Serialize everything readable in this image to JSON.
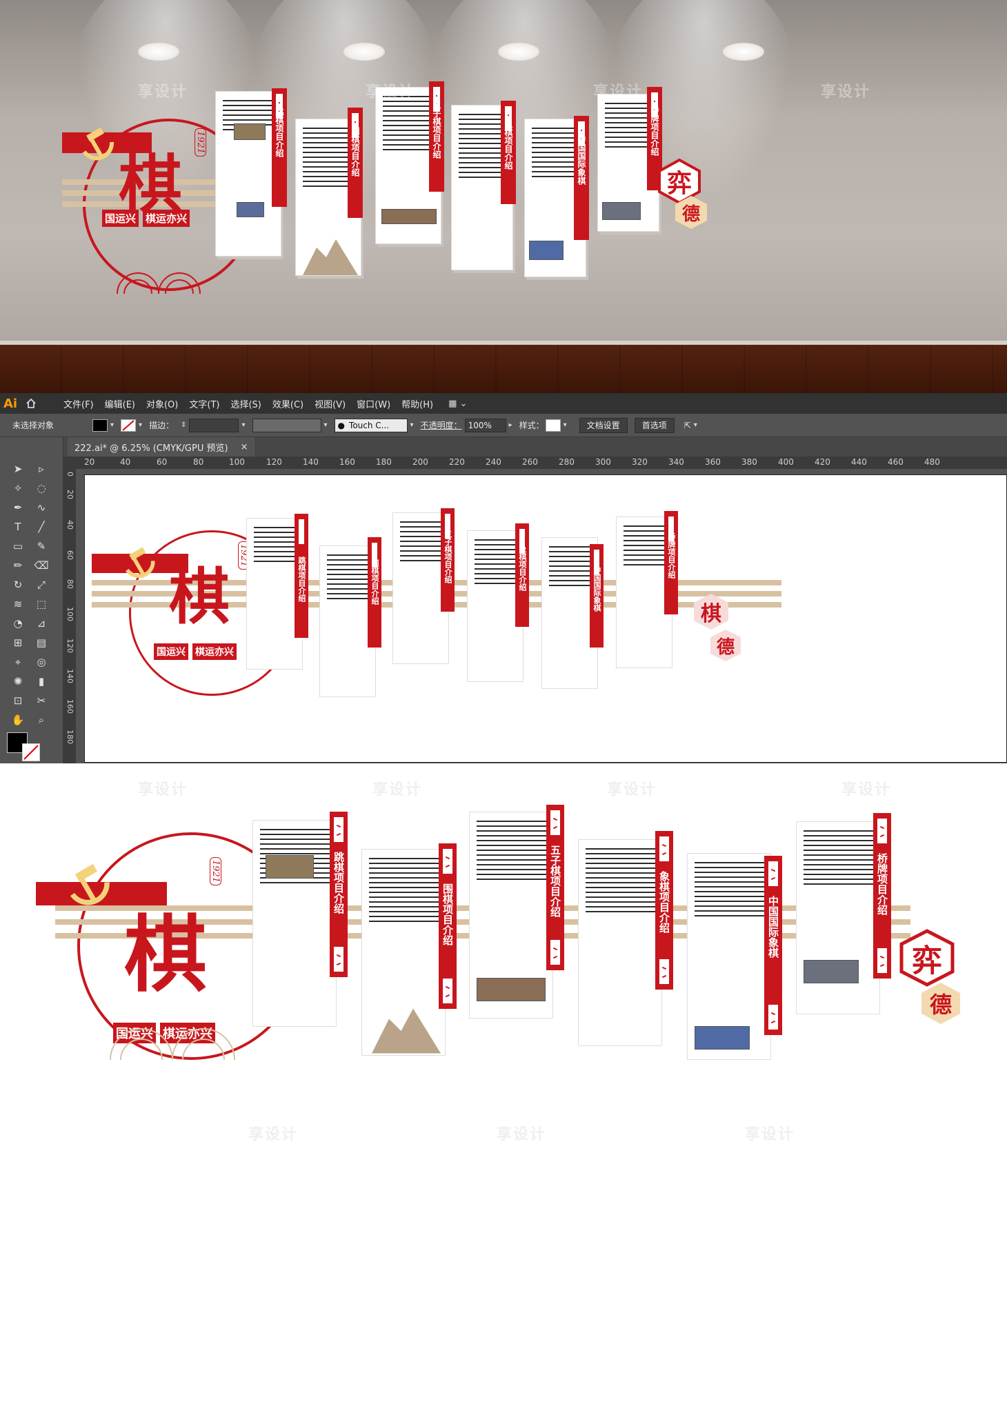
{
  "wall": {
    "main_char": "棋",
    "year": "1921",
    "slogan": [
      "国运兴",
      "棋运亦兴"
    ],
    "hex_chars": [
      "弈",
      "德"
    ],
    "panels": [
      {
        "title": "跳棋项目介绍"
      },
      {
        "title": "围棋项目介绍"
      },
      {
        "title": "五子棋项目介绍"
      },
      {
        "title": "象棋项目介绍"
      },
      {
        "title": "中国国际象棋"
      },
      {
        "title": "桥牌项目介绍"
      }
    ],
    "watermark": "享设计"
  },
  "illustrator": {
    "app_logo": "Ai",
    "menu": [
      "文件(F)",
      "编辑(E)",
      "对象(O)",
      "文字(T)",
      "选择(S)",
      "效果(C)",
      "视图(V)",
      "窗口(W)",
      "帮助(H)"
    ],
    "control": {
      "selection": "未选择对象",
      "stroke_label": "描边：",
      "brush": "Touch C...",
      "opacity_label": "不透明度：",
      "opacity_value": "100%",
      "style_label": "样式：",
      "doc_setup": "文档设置",
      "prefs": "首选项"
    },
    "doc_tab": {
      "title": "222.ai* @ 6.25% (CMYK/GPU 预览)",
      "close": "×"
    },
    "ruler_h": [
      "100",
      "120",
      "140",
      "160",
      "180",
      "200",
      "220",
      "240",
      "260",
      "280",
      "300",
      "320",
      "340",
      "360",
      "380",
      "400",
      "420",
      "440",
      "460",
      "480"
    ],
    "ruler_h_left": [
      "20",
      "40",
      "60",
      "80"
    ],
    "ruler_v": [
      "0",
      "20",
      "40",
      "60",
      "80",
      "100",
      "120",
      "140",
      "160",
      "180"
    ],
    "artboard_hex_chars": [
      "棋",
      "德"
    ]
  },
  "flat": {
    "hex_chars": [
      "弈",
      "德"
    ]
  },
  "colors": {
    "brand_red": "#c8161d",
    "beige": "#d8c1a1",
    "ui_dark": "#323232",
    "ui_mid": "#535353"
  },
  "icons": [
    "home-icon",
    "workspace-icon",
    "selection-tool-icon",
    "direct-select-icon",
    "pen-icon",
    "type-icon",
    "line-icon",
    "rectangle-icon",
    "brush-icon",
    "pencil-icon",
    "eraser-icon",
    "rotate-icon",
    "scale-icon",
    "shape-builder-icon",
    "gradient-icon",
    "eyedropper-icon",
    "blend-icon",
    "symbol-icon",
    "graph-icon",
    "artboard-icon",
    "slice-icon",
    "hand-icon",
    "zoom-icon"
  ]
}
